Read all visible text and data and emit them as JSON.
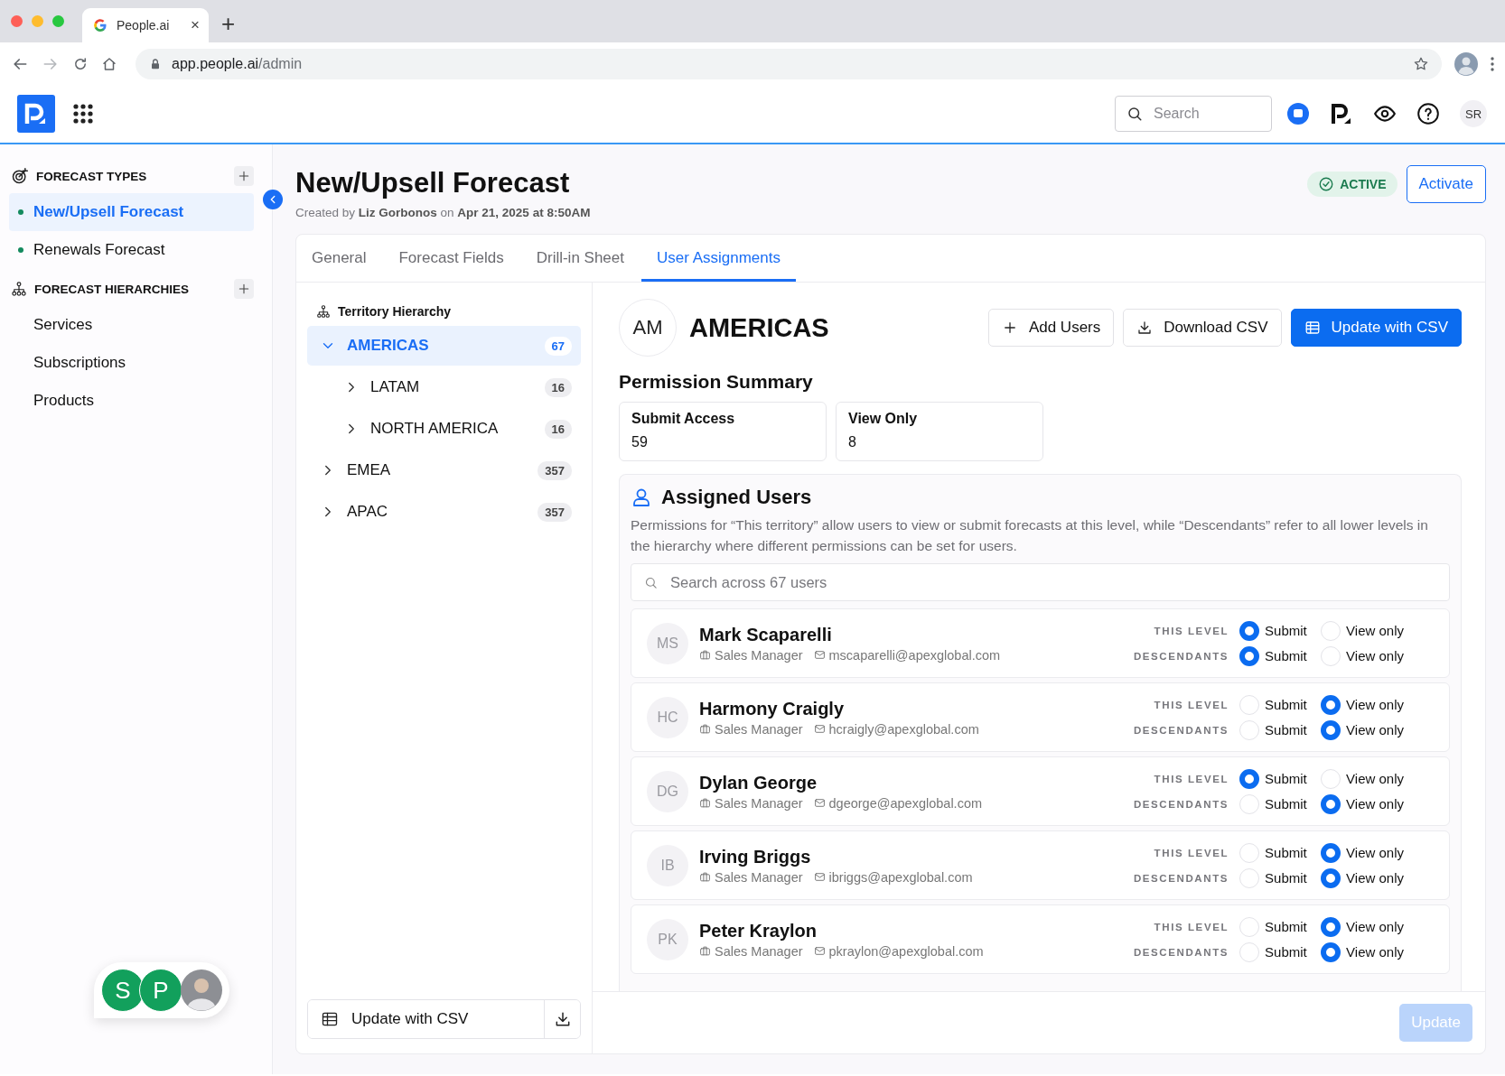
{
  "browser": {
    "tab_title": "People.ai",
    "tab_close": "×",
    "new_tab": "+",
    "url_host": "app.people.ai",
    "url_path": "/admin"
  },
  "topbar": {
    "search_placeholder": "Search",
    "user_initials": "SR"
  },
  "sidebar": {
    "sections": [
      {
        "kind": "types",
        "title": "FORECAST TYPES",
        "items": [
          {
            "label": "New/Upsell Forecast",
            "selected": true
          },
          {
            "label": "Renewals Forecast",
            "selected": false
          }
        ]
      },
      {
        "kind": "hierarchies",
        "title": "FORECAST HIERARCHIES",
        "items": [
          {
            "label": "Services",
            "selected": false
          },
          {
            "label": "Subscriptions",
            "selected": false
          },
          {
            "label": "Products",
            "selected": false
          }
        ]
      }
    ]
  },
  "page": {
    "title": "New/Upsell Forecast",
    "subtitle": "Created by **Liz Gorbonos** on **Apr 21, 2025 at 8:50AM**",
    "status": "ACTIVE",
    "action": "Activate"
  },
  "tabs": [
    {
      "label": "General",
      "selected": false
    },
    {
      "label": "Forecast Fields",
      "selected": false
    },
    {
      "label": "Drill-in Sheet",
      "selected": false
    },
    {
      "label": "User Assignments",
      "selected": true
    }
  ],
  "tree": {
    "title": "Territory Hierarchy",
    "nodes": [
      {
        "label": "AMERICAS",
        "count": "67",
        "selected": true,
        "expanded": true,
        "children": [
          {
            "label": "LATAM",
            "count": "16",
            "selected": false,
            "expanded": false
          },
          {
            "label": "NORTH AMERICA",
            "count": "16",
            "selected": false,
            "expanded": false
          }
        ]
      },
      {
        "label": "EMEA",
        "count": "357",
        "selected": false,
        "expanded": false
      },
      {
        "label": "APAC",
        "count": "357",
        "selected": false,
        "expanded": false
      }
    ],
    "footer_button": "Update with CSV"
  },
  "territory": {
    "initials": "AM",
    "name": "AMERICAS",
    "buttons": [
      {
        "kind": "add",
        "label": "Add Users"
      },
      {
        "kind": "download",
        "label": "Download CSV"
      },
      {
        "kind": "primary",
        "label": "Update with CSV"
      }
    ]
  },
  "permission_summary": {
    "title": "Permission Summary",
    "cards": [
      {
        "label": "Submit Access",
        "value": "59"
      },
      {
        "label": "View Only",
        "value": "8"
      }
    ]
  },
  "assigned_users": {
    "title": "Assigned Users",
    "description": "Permissions for “This territory” allow users to view or submit forecasts at this level, while “Descendants” refer to all lower levels in the hierarchy where different permissions can be set for users.",
    "search_placeholder": "Search across 67 users",
    "users": [
      {
        "initials": "MS",
        "name": "Mark Scaparelli",
        "role": "Sales Manager",
        "email": "mscaparelli@apexglobal.com",
        "permissions": [
          {
            "label": "THIS LEVEL",
            "options": [
              {
                "label": "Submit",
                "selected": true
              },
              {
                "label": "View only",
                "selected": false
              }
            ]
          },
          {
            "label": "DESCENDANTS",
            "options": [
              {
                "label": "Submit",
                "selected": true
              },
              {
                "label": "View only",
                "selected": false
              }
            ]
          }
        ]
      },
      {
        "initials": "HC",
        "name": "Harmony Craigly",
        "role": "Sales Manager",
        "email": "hcraigly@apexglobal.com",
        "permissions": [
          {
            "label": "THIS LEVEL",
            "options": [
              {
                "label": "Submit",
                "selected": false
              },
              {
                "label": "View only",
                "selected": true
              }
            ]
          },
          {
            "label": "DESCENDANTS",
            "options": [
              {
                "label": "Submit",
                "selected": false
              },
              {
                "label": "View only",
                "selected": true
              }
            ]
          }
        ]
      },
      {
        "initials": "DG",
        "name": "Dylan George",
        "role": "Sales Manager",
        "email": "dgeorge@apexglobal.com",
        "permissions": [
          {
            "label": "THIS LEVEL",
            "options": [
              {
                "label": "Submit",
                "selected": true
              },
              {
                "label": "View only",
                "selected": false
              }
            ]
          },
          {
            "label": "DESCENDANTS",
            "options": [
              {
                "label": "Submit",
                "selected": false
              },
              {
                "label": "View only",
                "selected": true
              }
            ]
          }
        ]
      },
      {
        "initials": "IB",
        "name": "Irving Briggs",
        "role": "Sales Manager",
        "email": "ibriggs@apexglobal.com",
        "permissions": [
          {
            "label": "THIS LEVEL",
            "options": [
              {
                "label": "Submit",
                "selected": false
              },
              {
                "label": "View only",
                "selected": true
              }
            ]
          },
          {
            "label": "DESCENDANTS",
            "options": [
              {
                "label": "Submit",
                "selected": false
              },
              {
                "label": "View only",
                "selected": true
              }
            ]
          }
        ]
      },
      {
        "initials": "PK",
        "name": "Peter Kraylon",
        "role": "Sales Manager",
        "email": "pkraylon@apexglobal.com",
        "permissions": [
          {
            "label": "THIS LEVEL",
            "options": [
              {
                "label": "Submit",
                "selected": false
              },
              {
                "label": "View only",
                "selected": true
              }
            ]
          },
          {
            "label": "DESCENDANTS",
            "options": [
              {
                "label": "Submit",
                "selected": false
              },
              {
                "label": "View only",
                "selected": true
              }
            ]
          }
        ]
      }
    ]
  },
  "update_button": {
    "label": "Update",
    "disabled": true
  },
  "presence": {
    "initials": [
      "S",
      "P"
    ]
  }
}
